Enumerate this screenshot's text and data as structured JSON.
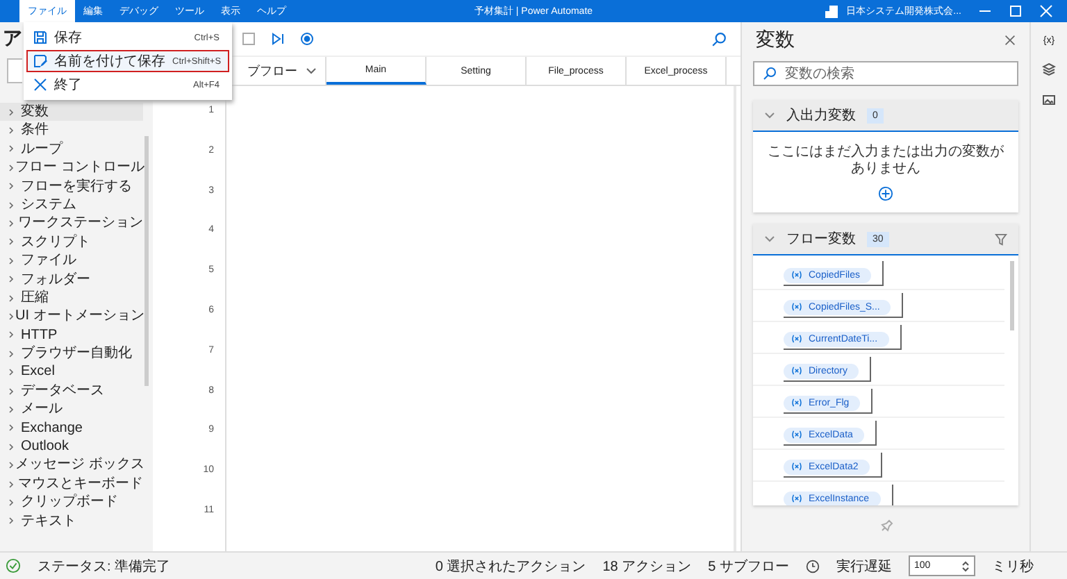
{
  "title_bar": {
    "menus": [
      {
        "label": "ファイル",
        "selected": true
      },
      {
        "label": "編集",
        "selected": false
      },
      {
        "label": "デバッグ",
        "selected": false
      },
      {
        "label": "ツール",
        "selected": false
      },
      {
        "label": "表示",
        "selected": false
      },
      {
        "label": "ヘルプ",
        "selected": false
      }
    ],
    "title": "予材集計 | Power Automate",
    "account": "日本システム開発株式会..."
  },
  "file_menu": {
    "items": [
      {
        "kind": "save",
        "label": "保存",
        "shortcut": "Ctrl+S",
        "selected": false
      },
      {
        "kind": "save-as",
        "label": "名前を付けて保存",
        "shortcut": "Ctrl+Shift+S",
        "selected": true
      },
      {
        "kind": "exit",
        "label": "終了",
        "shortcut": "Alt+F4",
        "selected": false
      }
    ]
  },
  "actions_panel": {
    "title": "ア",
    "categories": [
      {
        "label": "変数",
        "expanded": false,
        "selected": true
      },
      {
        "label": "条件",
        "expanded": false,
        "selected": false
      },
      {
        "label": "ループ",
        "expanded": false,
        "selected": false
      },
      {
        "label": "フロー コントロール",
        "expanded": false,
        "selected": false
      },
      {
        "label": "フローを実行する",
        "expanded": false,
        "selected": false
      },
      {
        "label": "システム",
        "expanded": false,
        "selected": false
      },
      {
        "label": "ワークステーション",
        "expanded": false,
        "selected": false
      },
      {
        "label": "スクリプト",
        "expanded": false,
        "selected": false
      },
      {
        "label": "ファイル",
        "expanded": false,
        "selected": false
      },
      {
        "label": "フォルダー",
        "expanded": false,
        "selected": false
      },
      {
        "label": "圧縮",
        "expanded": false,
        "selected": false
      },
      {
        "label": "UI オートメーション",
        "expanded": false,
        "selected": false
      },
      {
        "label": "HTTP",
        "expanded": false,
        "selected": false
      },
      {
        "label": "ブラウザー自動化",
        "expanded": false,
        "selected": false
      },
      {
        "label": "Excel",
        "expanded": false,
        "selected": false
      },
      {
        "label": "データベース",
        "expanded": false,
        "selected": false
      },
      {
        "label": "メール",
        "expanded": false,
        "selected": false
      },
      {
        "label": "Exchange",
        "expanded": false,
        "selected": false
      },
      {
        "label": "Outlook",
        "expanded": false,
        "selected": false
      },
      {
        "label": "メッセージ ボックス",
        "expanded": false,
        "selected": false
      },
      {
        "label": "マウスとキーボード",
        "expanded": false,
        "selected": false
      },
      {
        "label": "クリップボード",
        "expanded": false,
        "selected": false
      },
      {
        "label": "テキスト",
        "expanded": false,
        "selected": false
      }
    ]
  },
  "editor": {
    "subflow_dropdown": "ブフロー",
    "tabs": [
      {
        "label": "Main",
        "selected": true
      },
      {
        "label": "Setting",
        "selected": false
      },
      {
        "label": "File_process",
        "selected": false
      },
      {
        "label": "Excel_process",
        "selected": false
      }
    ],
    "line_numbers": [
      "1",
      "2",
      "3",
      "4",
      "5",
      "6",
      "7",
      "8",
      "9",
      "10",
      "11"
    ]
  },
  "variables_panel": {
    "title": "変数",
    "search": {
      "placeholder": "変数の検索"
    },
    "io_section": {
      "title": "入出力変数",
      "count": "0",
      "expanded": true,
      "empty_text": "ここにはまだ入力または出力の変数がありません"
    },
    "flow_section": {
      "title": "フロー変数",
      "count": "30",
      "expanded": true,
      "variables": [
        "CopiedFiles",
        "CopiedFiles_S...",
        "CurrentDateTi...",
        "Directory",
        "Error_Flg",
        "ExcelData",
        "ExcelData2",
        "ExcelInstance"
      ]
    }
  },
  "right_rail": {
    "variables_label": "{x}"
  },
  "status_bar": {
    "status": "ステータス: 準備完了",
    "selected_actions": "0 選択されたアクション",
    "actions": "18 アクション",
    "subflows": "5 サブフロー",
    "delay_label": "実行遅延",
    "delay_value": "100",
    "unit": "ミリ秒"
  }
}
